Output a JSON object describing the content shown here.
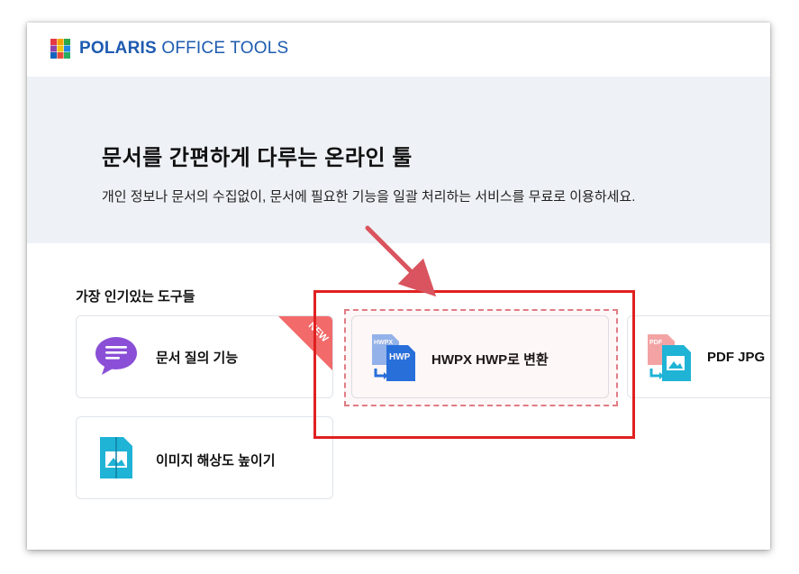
{
  "brand": {
    "name_bold": "POLARIS",
    "name_rest": " OFFICE TOOLS",
    "color": "#1e5bb0"
  },
  "hero": {
    "title": "문서를 간편하게 다루는 온라인 툴",
    "subtitle": "개인 정보나 문서의 수집없이, 문서에 필요한 기능을 일괄 처리하는 서비스를 무료로 이용하세요."
  },
  "tools": {
    "section_title": "가장 인기있는 도구들",
    "items": [
      {
        "label": "문서 질의 기능",
        "icon": "chat-bubble-icon",
        "badge": "NEW"
      },
      {
        "label": "HWPX HWP로 변환",
        "icon": "hwpx-to-hwp-icon",
        "icon_text_top": "HWPX",
        "icon_text_main": "HWP"
      },
      {
        "label": "PDF JPG",
        "icon": "pdf-to-jpg-icon",
        "icon_text_top": "PDF"
      },
      {
        "label": "이미지 해상도 높이기",
        "icon": "image-upscale-icon"
      }
    ]
  },
  "annotation": {
    "highlight_color": "#e02020",
    "arrow_color": "#d9545e"
  }
}
